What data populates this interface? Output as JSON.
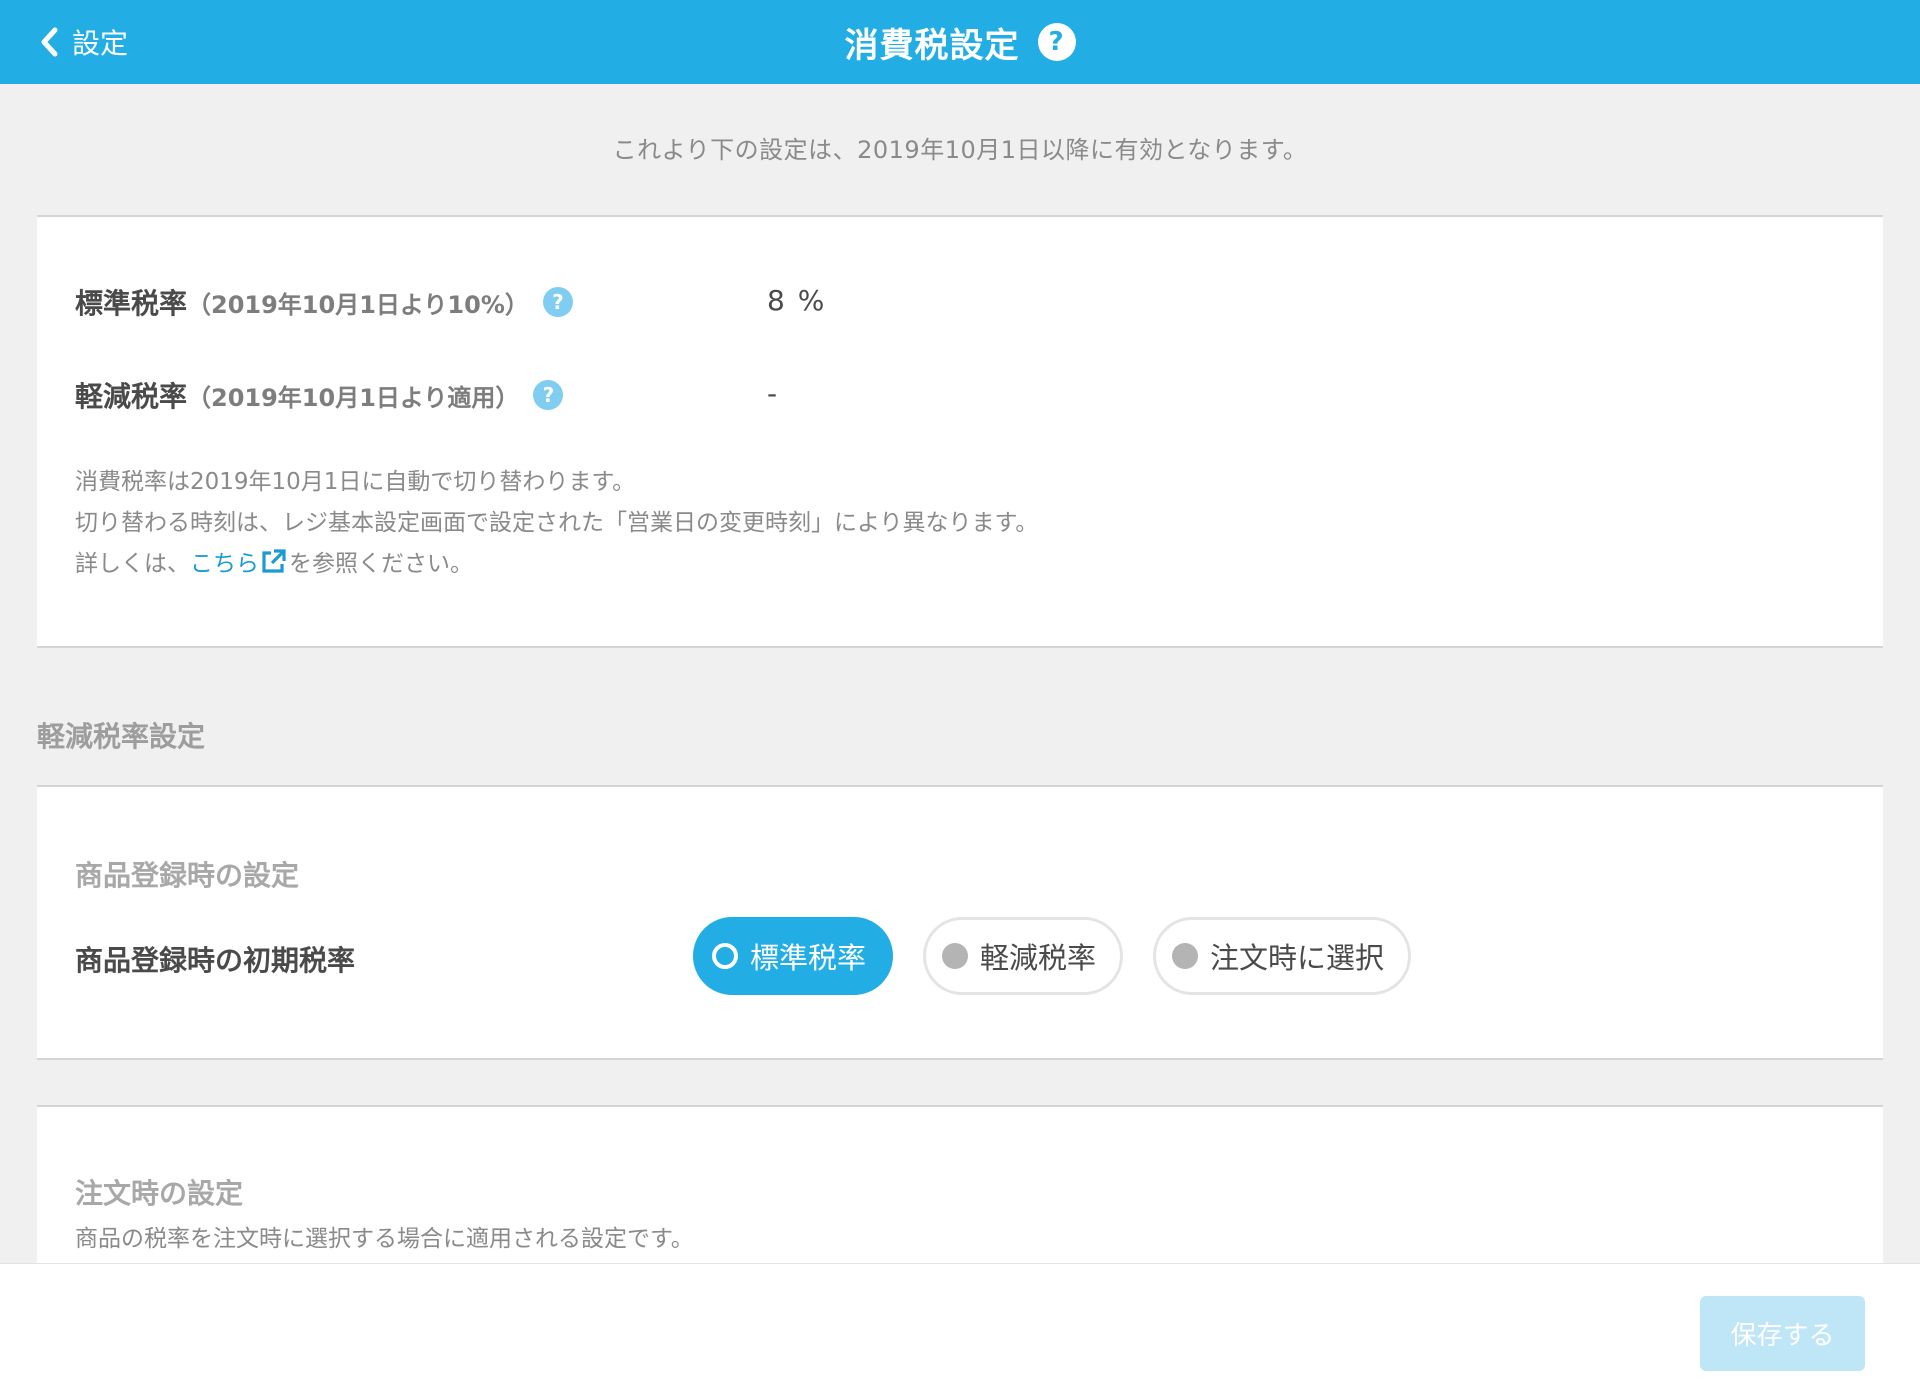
{
  "header": {
    "back_label": "設定",
    "title": "消費税設定",
    "help_glyph": "?",
    "color": "#22aee4"
  },
  "notice": "これより下の設定は、2019年10月1日以降に有効となります。",
  "rates": {
    "standard": {
      "label": "標準税率",
      "sub": "（2019年10月1日より10%）",
      "value": "8 %"
    },
    "reduced": {
      "label": "軽減税率",
      "sub": "（2019年10月1日より適用）",
      "value": "-"
    },
    "help_glyph": "?"
  },
  "description": {
    "line1": "消費税率は2019年10月1日に自動で切り替わります。",
    "line2": "切り替わる時刻は、レジ基本設定画面で設定された「営業日の変更時刻」により異なります。",
    "line3_prefix": "詳しくは、",
    "link_text": "こちら",
    "line3_suffix": "を参照ください。"
  },
  "reduced_settings": {
    "section_title": "軽減税率設定",
    "product_registration": {
      "title": "商品登録時の設定",
      "field_label": "商品登録時の初期税率",
      "options": [
        {
          "label": "標準税率",
          "selected": true
        },
        {
          "label": "軽減税率",
          "selected": false
        },
        {
          "label": "注文時に選択",
          "selected": false
        }
      ]
    },
    "order_time": {
      "title": "注文時の設定",
      "description": "商品の税率を注文時に選択する場合に適用される設定です。"
    }
  },
  "footer": {
    "save_label": "保存する"
  }
}
